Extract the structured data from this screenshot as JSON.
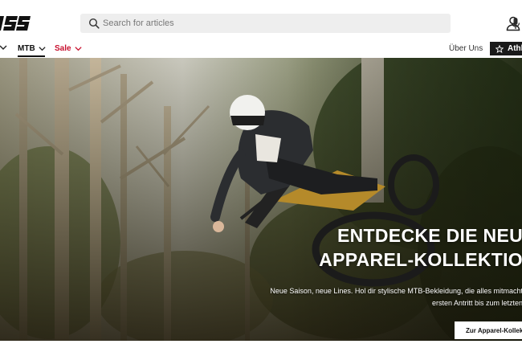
{
  "header": {
    "logo_text": "iXS",
    "search": {
      "placeholder": "Search for articles",
      "value": ""
    },
    "icons": {
      "search": "search-icon",
      "mic": "microphone-icon",
      "account": "user-icon"
    }
  },
  "nav": {
    "items": [
      {
        "label": "MTB",
        "active": true
      },
      {
        "label": "Sale",
        "color": "#c8102e"
      }
    ],
    "right": {
      "about_label": "Über Uns",
      "athletes_label": "Athl"
    }
  },
  "hero": {
    "headline_line1": "ENTDECKE DIE NEU",
    "headline_line2": "APPAREL-KOLLEKTIO",
    "sub_line1": "Neue Saison, neue Lines. Hol dir stylische MTB-Bekleidung, die alles mitmacht",
    "sub_line2": "ersten Antritt bis zum letzten",
    "cta_label": "Zur Apparel-Kollekt"
  },
  "colors": {
    "accent_red": "#c8102e",
    "dark_button": "#1a1a1a"
  }
}
